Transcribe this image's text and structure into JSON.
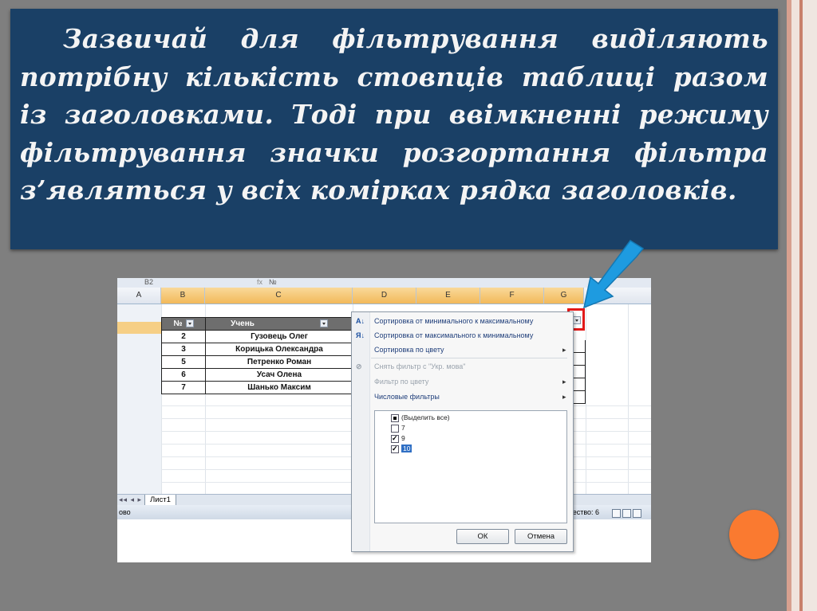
{
  "slide": {
    "text": "Зазвичай для фільтрування виділяють потрібну кількість стовпців таблиці разом із заголовками. Тоді при ввімкненні режиму фільтрування значки розгортання фільтра з’являться у всіх комірках рядка заголовків.",
    "colors": {
      "background": "#7f7f7f",
      "text_box": "#1a4066",
      "arrow": "#1e9be0",
      "highlight": "#e11919",
      "dot": "#fa7a30"
    }
  },
  "excel": {
    "name_box": "B2",
    "fx_symbol": "fx",
    "formula_value": "№",
    "columns": [
      "A",
      "B",
      "C",
      "D",
      "E",
      "F",
      "G"
    ],
    "table": {
      "headers": [
        "№",
        "Учень"
      ],
      "rows": [
        [
          "2",
          "Гузовець Олег"
        ],
        [
          "3",
          "Корицька Олександра"
        ],
        [
          "5",
          "Петренко Роман"
        ],
        [
          "6",
          "Усач Олена"
        ],
        [
          "7",
          "Шанько Максим"
        ]
      ]
    },
    "sheet_nav": "◂◂ ◂ ▸ ▸▸",
    "sheet_tab": "Лист1",
    "status_left": "ово",
    "status_right": "чество: 6"
  },
  "filter_menu": {
    "items": [
      {
        "label": "Сортировка от минимального к максимальному",
        "icon": "sort-ascending-icon",
        "disabled": false
      },
      {
        "label": "Сортировка от максимального к минимальному",
        "icon": "sort-descending-icon",
        "disabled": false
      },
      {
        "label": "Сортировка по цвету",
        "submenu": true,
        "disabled": false
      },
      {
        "label": "Снять фильтр с \"Укр. мова\"",
        "icon": "clear-filter-icon",
        "disabled": true
      },
      {
        "label": "Фильтр по цвету",
        "submenu": true,
        "disabled": true
      },
      {
        "label": "Числовые фильтры",
        "submenu": true,
        "disabled": false
      }
    ],
    "values": [
      {
        "label": "(Выделить все)",
        "state": "mixed"
      },
      {
        "label": "7",
        "state": "unchecked"
      },
      {
        "label": "9",
        "state": "checked"
      },
      {
        "label": "10",
        "state": "checked",
        "selected": true
      }
    ],
    "ok_label": "ОК",
    "cancel_label": "Отмена"
  }
}
